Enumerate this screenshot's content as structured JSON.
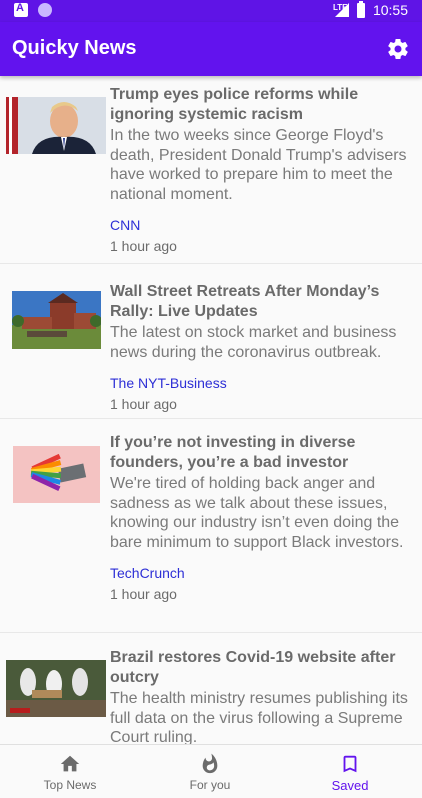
{
  "status_bar": {
    "time": "10:55",
    "network": "LTE"
  },
  "app_bar": {
    "title": "Quicky News",
    "settings_icon": "gear-icon"
  },
  "articles": [
    {
      "title": "Trump eyes police reforms while ignoring systemic racism",
      "description": "In the two weeks since George Floyd's death, President Donald Trump's advisers have worked to prepare him to meet the national moment.",
      "source": "CNN",
      "time": "1 hour ago"
    },
    {
      "title": "Wall Street Retreats After Monday’s Rally: Live Updates",
      "description": "The latest on stock market and business news during the coronavirus outbreak.",
      "source": "The NYT-Business",
      "time": "1 hour ago"
    },
    {
      "title": "If you’re not investing in diverse founders, you’re a bad investor",
      "description": "We're tired of holding back anger and sadness as we talk about these issues, knowing our industry isn’t even doing the bare minimum to support Black investors.",
      "source": "TechCrunch",
      "time": "1 hour ago"
    },
    {
      "title": "Brazil restores Covid-19 website after outcry",
      "description": "The health ministry resumes publishing its full data on the virus following a Supreme Court ruling.",
      "source": "",
      "time": ""
    }
  ],
  "bottom_nav": [
    {
      "label": "Top News",
      "icon": "home-icon",
      "active": false
    },
    {
      "label": "For you",
      "icon": "flame-icon",
      "active": false
    },
    {
      "label": "Saved",
      "icon": "bookmark-icon",
      "active": true
    }
  ],
  "colors": {
    "primary": "#6213ee",
    "status_bar": "#5f14e6",
    "link": "#2d2fd6"
  }
}
